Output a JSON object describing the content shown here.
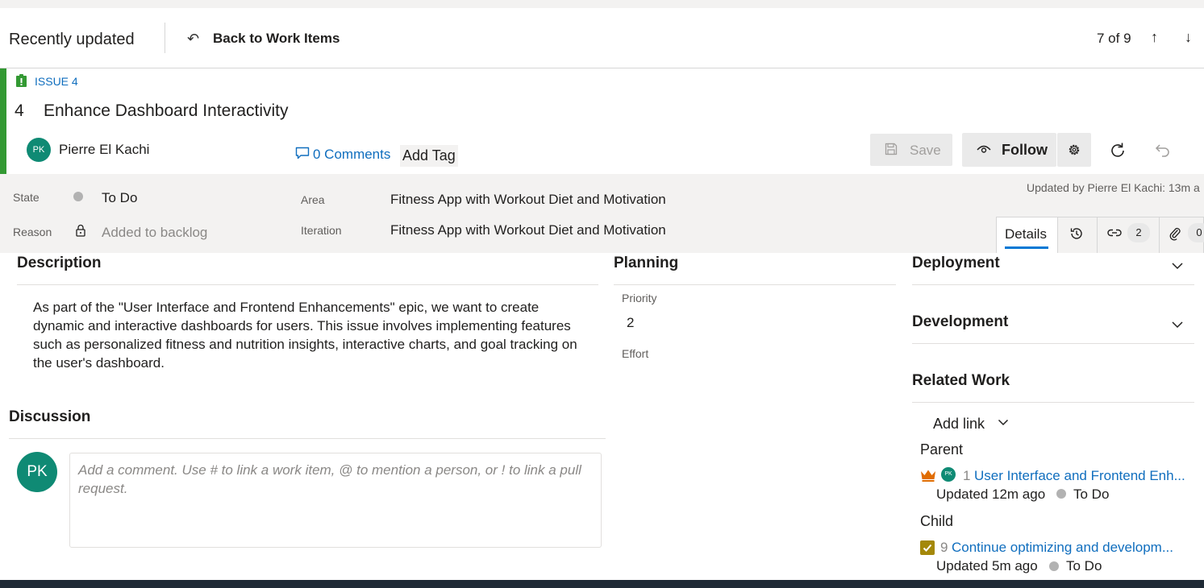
{
  "nav": {
    "title": "Recently updated",
    "back_label": "Back to Work Items",
    "pager": "7 of 9"
  },
  "work_item": {
    "type_label": "ISSUE 4",
    "id": "4",
    "title": "Enhance Dashboard Interactivity",
    "assignee_initials": "PK",
    "assignee": "Pierre El Kachi",
    "comments_label": "0 Comments",
    "add_tag_label": "Add Tag",
    "updated_by": "Updated by Pierre El Kachi: 13m a"
  },
  "toolbar": {
    "save_label": "Save",
    "follow_label": "Follow"
  },
  "fields": {
    "state_label": "State",
    "state_value": "To Do",
    "reason_label": "Reason",
    "reason_value": "Added to backlog",
    "area_label": "Area",
    "area_value": "Fitness App with Workout Diet and Motivation",
    "iteration_label": "Iteration",
    "iteration_value": "Fitness App with Workout Diet and Motivation"
  },
  "tabs": {
    "details_label": "Details",
    "links_count": "2",
    "attachments_count": "0"
  },
  "description": {
    "title": "Description",
    "text": "As part of the \"User Interface and Frontend Enhancements\" epic, we want to create dynamic and interactive dashboards for users. This issue involves implementing features such as personalized fitness and nutrition insights, interactive charts, and goal tracking on the user's dashboard."
  },
  "discussion": {
    "title": "Discussion",
    "avatar_initials": "PK",
    "placeholder": "Add a comment. Use # to link a work item, @ to mention a person, or ! to link a pull request."
  },
  "planning": {
    "title": "Planning",
    "priority_label": "Priority",
    "priority_value": "2",
    "effort_label": "Effort"
  },
  "deployment": {
    "title": "Deployment"
  },
  "development": {
    "title": "Development"
  },
  "related_work": {
    "title": "Related Work",
    "add_link_label": "Add link",
    "parent_label": "Parent",
    "parent": {
      "avatar_initials": "PK",
      "id": "1",
      "title": "User Interface and Frontend Enh...",
      "updated": "Updated 12m ago",
      "state": "To Do"
    },
    "child_label": "Child",
    "child": {
      "id": "9",
      "title": "Continue optimizing and developm...",
      "updated": "Updated 5m ago",
      "state": "To Do"
    }
  },
  "colors": {
    "accent": "#0078d4",
    "link": "#106ebe",
    "issue_green": "#339933",
    "avatar_teal": "#0f8a74",
    "epic_orange": "#e06c00",
    "task_yellow": "#a4880a",
    "state_gray": "#b2b2b2"
  },
  "icons": {
    "back": "arrow-back-icon",
    "up": "arrow-up-icon",
    "down": "arrow-down-icon",
    "issue": "issue-icon",
    "comments": "comment-icon",
    "save": "save-icon",
    "follow": "eye-icon",
    "settings": "gear-icon",
    "refresh": "refresh-icon",
    "undo": "undo-icon",
    "lock": "lock-icon",
    "history": "history-icon",
    "links": "link-icon",
    "attachments": "paperclip-icon",
    "chevron": "chevron-down-icon",
    "epic": "crown-icon",
    "task": "checkbox-icon"
  }
}
